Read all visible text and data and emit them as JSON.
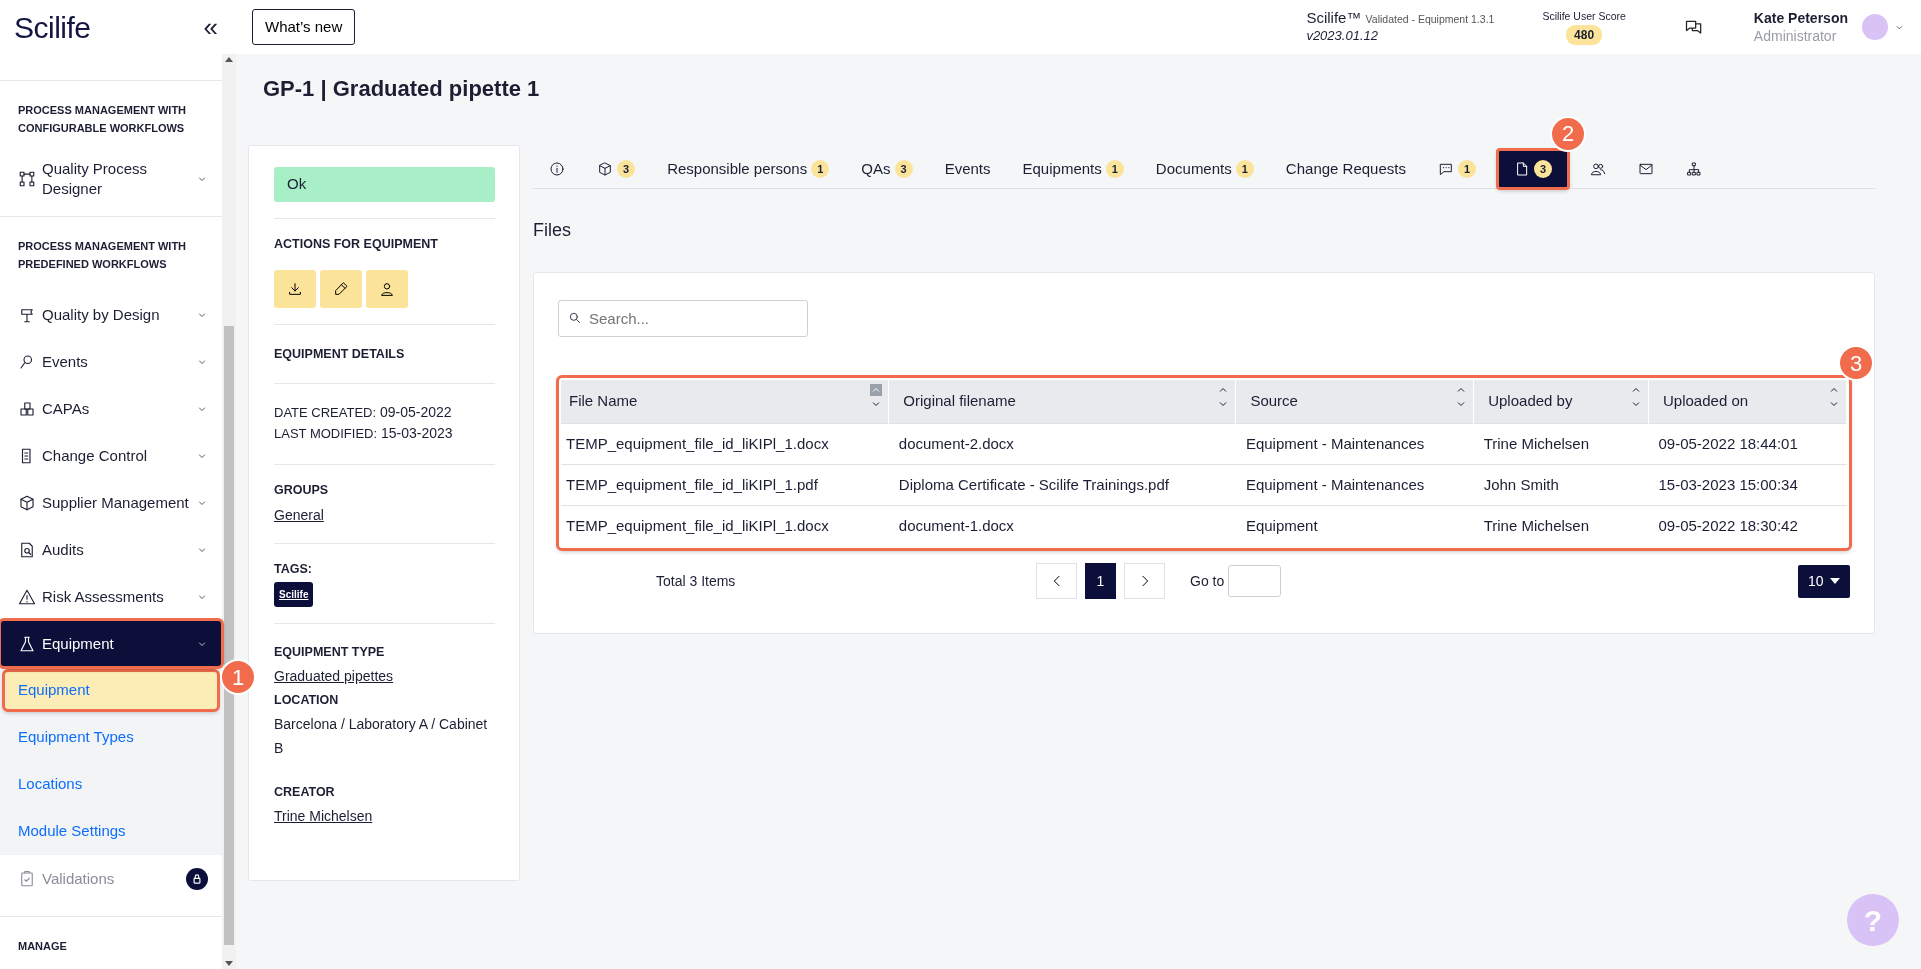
{
  "sidebar": {
    "logo": "Scilife",
    "collapse": "«",
    "sections": [
      {
        "heading": "PROCESS MANAGEMENT WITH CONFIGURABLE WORKFLOWS",
        "items": [
          {
            "label": "Quality Process Designer",
            "selected": false,
            "locked": false,
            "highlighted": false
          }
        ]
      },
      {
        "heading": "PROCESS MANAGEMENT WITH PREDEFINED WORKFLOWS",
        "items": [
          {
            "label": "Quality by Design",
            "selected": false,
            "locked": false,
            "highlighted": false
          },
          {
            "label": "Events",
            "selected": false,
            "locked": false,
            "highlighted": false
          },
          {
            "label": "CAPAs",
            "selected": false,
            "locked": false,
            "highlighted": false
          },
          {
            "label": "Change Control",
            "selected": false,
            "locked": false,
            "highlighted": false
          },
          {
            "label": "Supplier Management",
            "selected": false,
            "locked": false,
            "highlighted": false
          },
          {
            "label": "Audits",
            "selected": false,
            "locked": false,
            "highlighted": false
          },
          {
            "label": "Risk Assessments",
            "selected": false,
            "locked": false,
            "highlighted": false
          },
          {
            "label": "Equipment",
            "selected": true,
            "locked": false,
            "highlighted": true,
            "callout": "1",
            "children": [
              {
                "label": "Equipment",
                "selected": true,
                "highlighted": true
              },
              {
                "label": "Equipment Types",
                "selected": false,
                "highlighted": false
              },
              {
                "label": "Locations",
                "selected": false,
                "highlighted": false
              },
              {
                "label": "Module Settings",
                "selected": false,
                "highlighted": false
              }
            ]
          },
          {
            "label": "Validations",
            "selected": false,
            "locked": true,
            "highlighted": false
          }
        ]
      },
      {
        "heading": "MANAGE"
      }
    ]
  },
  "header": {
    "whats_new": "What’s new",
    "product": "Scilife™",
    "validated": "Validated - Equipment 1.3.1",
    "version": "v2023.01.12",
    "score_label": "Scilife User Score",
    "score": "480",
    "user_name": "Kate Peterson",
    "user_role": "Administrator"
  },
  "page_title": "GP-1 | Graduated pipette 1",
  "details": {
    "status": "Ok",
    "actions_heading": "ACTIONS FOR EQUIPMENT",
    "details_heading": "EQUIPMENT DETAILS",
    "dates": [
      {
        "label": "DATE CREATED:",
        "value": "09-05-2022"
      },
      {
        "label": "LAST MODIFIED:",
        "value": "15-03-2023"
      }
    ],
    "groups_heading": "GROUPS",
    "group": "General",
    "tags_heading": "TAGS:",
    "tag": "Scilife",
    "type_heading": "EQUIPMENT TYPE",
    "type": "Graduated pipettes",
    "location_heading": "LOCATION",
    "location": "Barcelona / Laboratory A / Cabinet B",
    "creator_heading": "CREATOR",
    "creator": "Trine Michelsen"
  },
  "tabs": [
    {
      "kind": "icon",
      "selected": false,
      "highlighted": false
    },
    {
      "kind": "icon",
      "count": "3",
      "selected": false,
      "highlighted": false
    },
    {
      "kind": "text",
      "label": "Responsible persons",
      "count": "1",
      "selected": false,
      "highlighted": false
    },
    {
      "kind": "text",
      "label": "QAs",
      "count": "3",
      "selected": false,
      "highlighted": false
    },
    {
      "kind": "text",
      "label": "Events",
      "selected": false,
      "highlighted": false
    },
    {
      "kind": "text",
      "label": "Equipments",
      "count": "1",
      "selected": false,
      "highlighted": false
    },
    {
      "kind": "text",
      "label": "Documents",
      "count": "1",
      "selected": false,
      "highlighted": false
    },
    {
      "kind": "text",
      "label": "Change Requests",
      "selected": false,
      "highlighted": false
    },
    {
      "kind": "icon",
      "count": "1",
      "selected": false,
      "highlighted": false
    },
    {
      "kind": "icon",
      "count": "3",
      "selected": true,
      "highlighted": true,
      "callout": "2"
    },
    {
      "kind": "icon",
      "selected": false,
      "highlighted": false
    },
    {
      "kind": "icon",
      "selected": false,
      "highlighted": false
    },
    {
      "kind": "icon",
      "selected": false,
      "highlighted": false
    }
  ],
  "files": {
    "heading": "Files",
    "search": {
      "placeholder": "Search..."
    },
    "table": {
      "highlighted": true,
      "callout": "3",
      "columns": [
        {
          "label": "File Name",
          "sorted": true
        },
        {
          "label": "Original filename",
          "sorted": false
        },
        {
          "label": "Source",
          "sorted": false
        },
        {
          "label": "Uploaded by",
          "sorted": false
        },
        {
          "label": "Uploaded on",
          "sorted": false
        }
      ],
      "rows": [
        [
          "TEMP_equipment_file_id_liKIPl_1.docx",
          "document-2.docx",
          "Equipment - Maintenances",
          "Trine Michelsen",
          "09-05-2022 18:44:01"
        ],
        [
          "TEMP_equipment_file_id_liKIPl_1.pdf",
          "Diploma Certificate - Scilife Trainings.pdf",
          "Equipment - Maintenances",
          "John Smith",
          "15-03-2023 15:00:34"
        ],
        [
          "TEMP_equipment_file_id_liKIPl_1.docx",
          "document-1.docx",
          "Equipment",
          "Trine Michelsen",
          "09-05-2022 18:30:42"
        ]
      ]
    },
    "pagination": {
      "total": "Total 3 Items",
      "pages": [
        {
          "label": "1",
          "selected": true
        }
      ],
      "goto_label": "Go to",
      "page_size": "10"
    }
  },
  "help": "?"
}
